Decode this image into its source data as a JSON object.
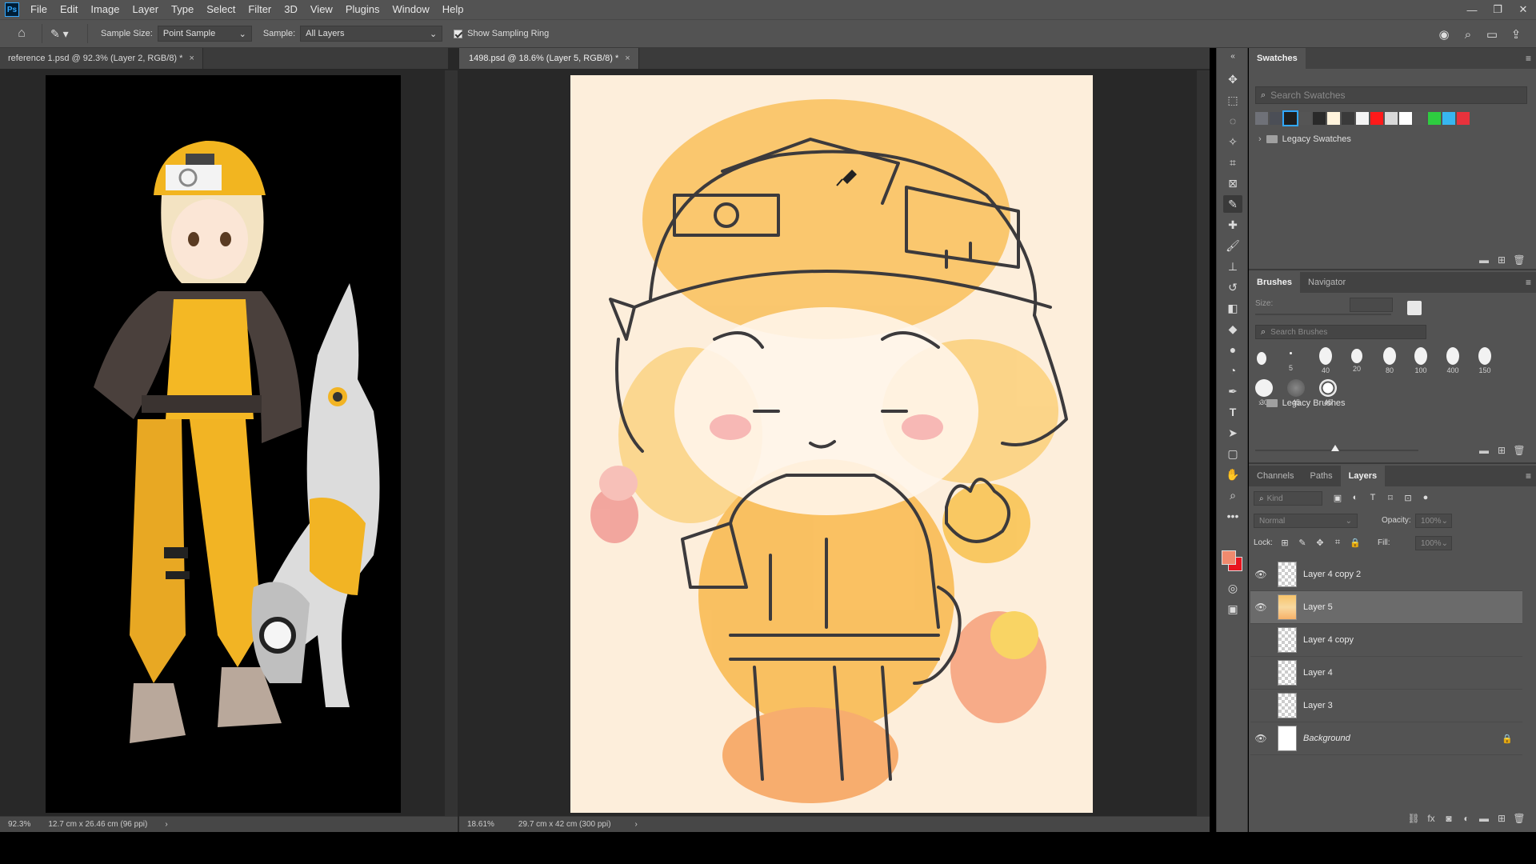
{
  "menubar": {
    "logo": "Ps",
    "items": [
      "File",
      "Edit",
      "Image",
      "Layer",
      "Type",
      "Select",
      "Filter",
      "3D",
      "View",
      "Plugins",
      "Window",
      "Help"
    ],
    "window_controls": [
      "—",
      "❐",
      "✕"
    ]
  },
  "options": {
    "sample_size_label": "Sample Size:",
    "sample_size_value": "Point Sample",
    "sample_label": "Sample:",
    "sample_value": "All Layers",
    "show_ring_label": "Show Sampling Ring"
  },
  "documents": [
    {
      "tab": "reference 1.psd @ 92.3% (Layer 2, RGB/8) *",
      "zoom": "92.3%",
      "dimensions": "12.7 cm x 26.46 cm (96 ppi)"
    },
    {
      "tab": "1498.psd @ 18.6% (Layer 5, RGB/8) *",
      "zoom": "18.61%",
      "dimensions": "29.7 cm x 42 cm (300 ppi)"
    }
  ],
  "swatches": {
    "tab": "Swatches",
    "search_placeholder": "Search Swatches",
    "colors": [
      "#6f7178",
      "#4b4e56",
      "#1e1e1e",
      "#555555",
      "#2a2a2a",
      "#fff3dc",
      "#3a3a3a",
      "#f4f4f4",
      "#ff1a1a",
      "#d9d9d9",
      "#ffffff",
      "#555555",
      "#2ecc40",
      "#37b6f0",
      "#e8323c"
    ],
    "folder": "Legacy Swatches"
  },
  "brushes": {
    "tabs": [
      "Brushes",
      "Navigator"
    ],
    "size_label": "Size:",
    "search_placeholder": "Search Brushes",
    "sizes": [
      "",
      "5",
      "40",
      "20",
      "80",
      "100",
      "400",
      "150",
      "30",
      "45",
      "45"
    ],
    "folder": "Legacy Brushes"
  },
  "layers_panel": {
    "tabs": [
      "Channels",
      "Paths",
      "Layers"
    ],
    "kind_placeholder": "Kind",
    "blend_mode": "Normal",
    "opacity_label": "Opacity:",
    "opacity_value": "100%",
    "lock_label": "Lock:",
    "fill_label": "Fill:",
    "fill_value": "100%",
    "layers": [
      {
        "name": "Layer 4 copy 2",
        "visible": true,
        "selected": false
      },
      {
        "name": "Layer 5",
        "visible": true,
        "selected": true
      },
      {
        "name": "Layer 4 copy",
        "visible": false,
        "selected": false
      },
      {
        "name": "Layer 4",
        "visible": false,
        "selected": false
      },
      {
        "name": "Layer 3",
        "visible": false,
        "selected": false
      },
      {
        "name": "Background",
        "visible": true,
        "selected": false
      }
    ]
  },
  "colors": {
    "foreground": "#f08a6e",
    "background": "#e8141e"
  }
}
